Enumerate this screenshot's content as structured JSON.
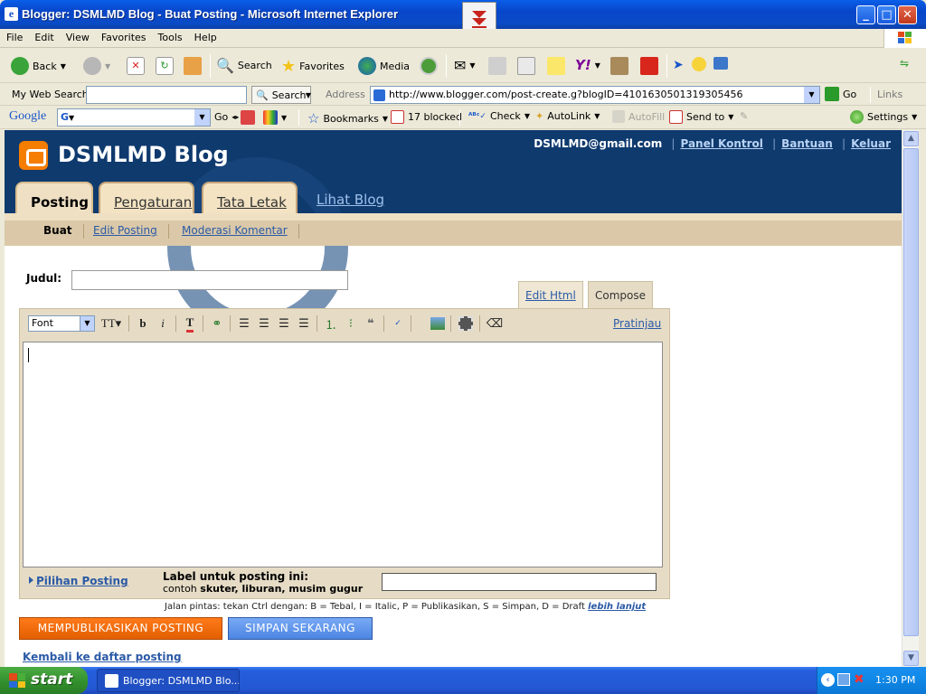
{
  "window": {
    "title": "Blogger: DSMLMD Blog - Buat Posting - Microsoft Internet Explorer"
  },
  "menu": [
    "File",
    "Edit",
    "View",
    "Favorites",
    "Tools",
    "Help"
  ],
  "toolbar": {
    "back": "Back",
    "search": "Search",
    "favorites": "Favorites",
    "media": "Media"
  },
  "addressbar": {
    "mywebsearch": "My Web Search",
    "search_btn": "Search",
    "address_label": "Address",
    "url": "http://www.blogger.com/post-create.g?blogID=4101630501319305456",
    "go": "Go",
    "links": "Links"
  },
  "googlebar": {
    "logo": "Google",
    "go": "Go",
    "bookmarks": "Bookmarks",
    "blocked": "17 blocked",
    "check": "Check",
    "autolink": "AutoLink",
    "autofill": "AutoFill",
    "sendto": "Send to",
    "settings": "Settings"
  },
  "header": {
    "blog_title": "DSMLMD Blog",
    "user_email": "DSMLMD@gmail.com",
    "links": [
      "Panel Kontrol",
      "Bantuan",
      "Keluar"
    ]
  },
  "tabs": [
    "Posting",
    "Pengaturan",
    "Tata Letak"
  ],
  "view_blog": "Lihat Blog",
  "subnav": [
    "Buat",
    "Edit Posting",
    "Moderasi Komentar"
  ],
  "form": {
    "title_label": "Judul:",
    "title_value": "",
    "mode_tabs": [
      "Edit Html",
      "Compose"
    ],
    "font_select": "Font",
    "preview": "Pratinjau",
    "post_options": "Pilihan Posting",
    "label_title": "Label untuk posting ini:",
    "label_example_prefix": "contoh",
    "label_example": "skuter, liburan, musim gugur",
    "label_value": ""
  },
  "shortcuts": {
    "text": "Jalan pintas: tekan Ctrl dengan: B = Tebal, I = Italic, P = Publikasikan, S = Simpan, D = Draft",
    "more": "lebih lanjut"
  },
  "buttons": {
    "publish": "MEMPUBLIKASIKAN POSTING",
    "save": "SIMPAN SEKARANG"
  },
  "back_link": "Kembali ke daftar posting",
  "taskbar": {
    "start": "start",
    "task": "Blogger: DSMLMD Blo...",
    "clock": "1:30 PM"
  }
}
